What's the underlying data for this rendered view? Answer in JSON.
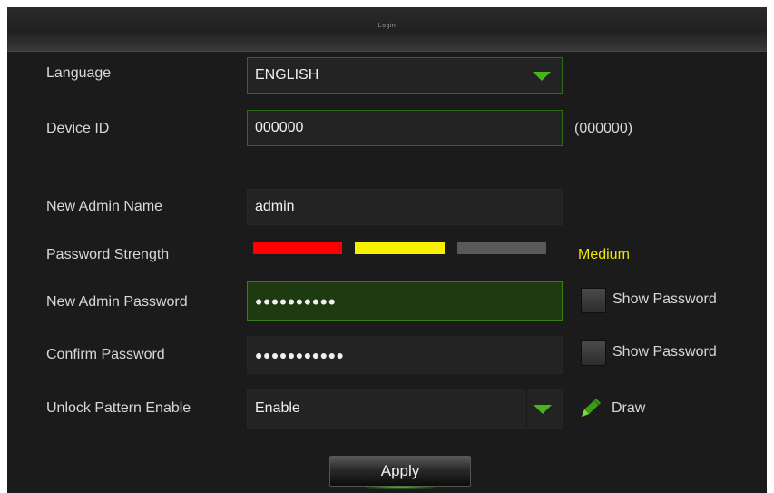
{
  "window": {
    "title": "Login"
  },
  "language": {
    "label": "Language",
    "value": "ENGLISH"
  },
  "device_id": {
    "label": "Device ID",
    "value": "000000",
    "hint": "(000000)"
  },
  "admin_name": {
    "label": "New Admin Name",
    "value": "admin"
  },
  "password_strength": {
    "label": "Password Strength",
    "level_text": "Medium",
    "level": 2,
    "max_level": 3,
    "colors": [
      "#ff0000",
      "#f7f000",
      "#5a5a5a"
    ],
    "level_text_color": "#f2e600"
  },
  "new_password": {
    "label": "New Admin Password",
    "masked_value": "●●●●●●●●●●",
    "show_label": "Show Password",
    "show_checked": false
  },
  "confirm_password": {
    "label": "Confirm Password",
    "masked_value": "●●●●●●●●●●●",
    "show_label": "Show Password",
    "show_checked": false
  },
  "unlock_pattern": {
    "label": "Unlock Pattern Enable",
    "value": "Enable",
    "draw_label": "Draw"
  },
  "apply_button": {
    "label": "Apply"
  },
  "icons": {
    "dropdown": "chevron-down-icon",
    "draw": "pencil-icon"
  },
  "accent_color": "#45b51a"
}
